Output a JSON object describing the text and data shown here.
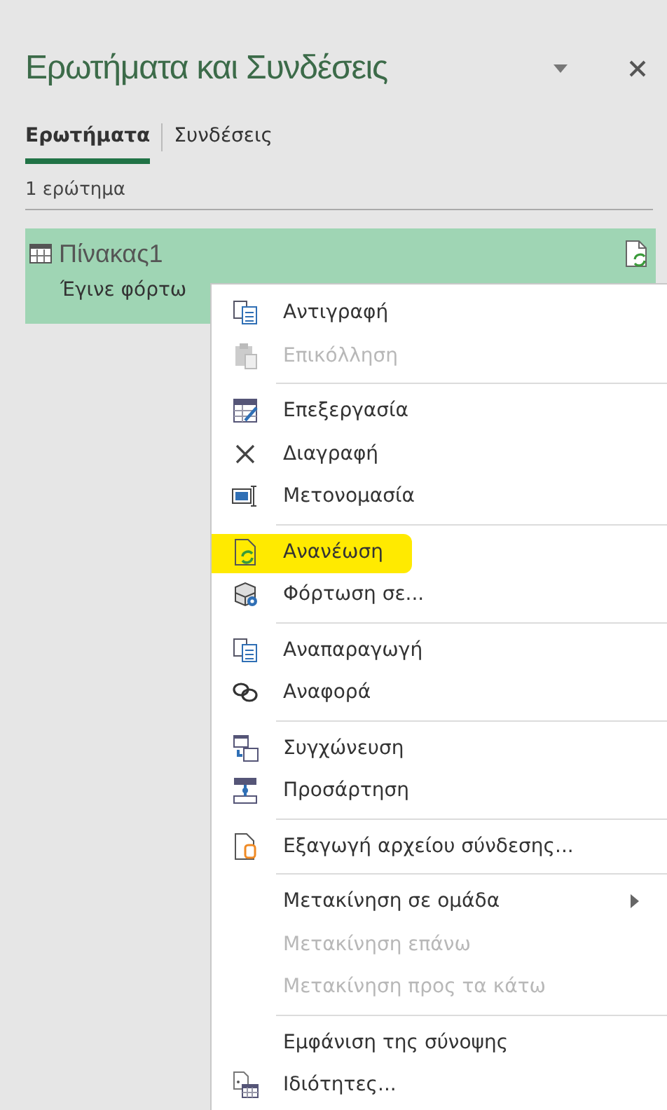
{
  "pane": {
    "title": "Ερωτήματα και Συνδέσεις",
    "tabs": [
      {
        "label": "Ερωτήματα",
        "selected": true
      },
      {
        "label": "Συνδέσεις",
        "selected": false
      }
    ],
    "count": "1 ερώτημα"
  },
  "query": {
    "name": "Πίνακας1",
    "status": "Έγινε φόρτω",
    "selected": true
  },
  "context_menu": {
    "groups": [
      [
        {
          "label": "Αντιγραφή",
          "disabled": false,
          "highlighted": false
        },
        {
          "label": "Επικόλληση",
          "disabled": true,
          "highlighted": false
        }
      ],
      [
        {
          "label": "Επεξεργασία",
          "disabled": false,
          "highlighted": false
        },
        {
          "label": "Διαγραφή",
          "disabled": false,
          "highlighted": false
        },
        {
          "label": "Μετονομασία",
          "disabled": false,
          "highlighted": false
        }
      ],
      [
        {
          "label": "Ανανέωση",
          "disabled": false,
          "highlighted": true
        },
        {
          "label": "Φόρτωση σε...",
          "disabled": false,
          "highlighted": false
        }
      ],
      [
        {
          "label": "Αναπαραγωγή",
          "disabled": false,
          "highlighted": false
        },
        {
          "label": "Αναφορά",
          "disabled": false,
          "highlighted": false
        }
      ],
      [
        {
          "label": "Συγχώνευση",
          "disabled": false,
          "highlighted": false
        },
        {
          "label": "Προσάρτηση",
          "disabled": false,
          "highlighted": false
        }
      ],
      [
        {
          "label": "Εξαγωγή αρχείου σύνδεσης...",
          "disabled": false,
          "highlighted": false
        }
      ],
      [
        {
          "label": "Μετακίνηση σε ομάδα",
          "disabled": false,
          "highlighted": false,
          "submenu": true
        },
        {
          "label": "Μετακίνηση επάνω",
          "disabled": true,
          "highlighted": false
        },
        {
          "label": "Μετακίνηση προς τα κάτω",
          "disabled": true,
          "highlighted": false
        }
      ],
      [
        {
          "label": "Εμφάνιση της σύνοψης",
          "disabled": false,
          "highlighted": false
        },
        {
          "label": "Ιδιότητες...",
          "disabled": false,
          "highlighted": false
        }
      ]
    ]
  }
}
